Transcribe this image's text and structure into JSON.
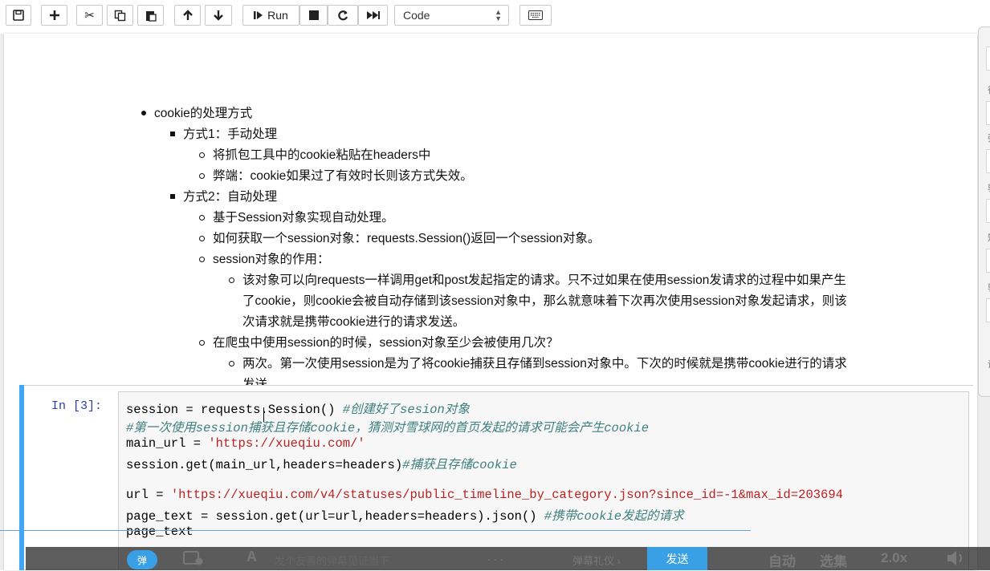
{
  "toolbar": {
    "run_label": "Run",
    "cell_type": "Code"
  },
  "markdown": {
    "items": [
      "cookie的处理方式",
      "方式1：手动处理",
      "将抓包工具中的cookie粘贴在headers中",
      "弊端：cookie如果过了有效时长则该方式失效。",
      "方式2：自动处理",
      "基于Session对象实现自动处理。",
      "如何获取一个session对象：requests.Session()返回一个session对象。",
      "session对象的作用：",
      "该对象可以向requests一样调用get和post发起指定的请求。只不过如果在使用session发请求的过程中如果产生",
      "了cookie，则cookie会被自动存储到该session对象中，那么就意味着下次再次使用session对象发起请求，则该",
      "次请求就是携带cookie进行的请求发送。",
      "在爬虫中使用session的时候，session对象至少会被使用几次？",
      "两次。第一次使用session是为了将cookie捕获且存储到session对象中。下次的时候就是携带cookie进行的请求",
      "发送。"
    ]
  },
  "code_cell": {
    "prompt": "In [3]:",
    "lines": [
      {
        "code": "session = requests.Session() ",
        "comment": "#创建好了sesion对象"
      },
      {
        "code": "",
        "comment": "#第一次使用session捕获且存储cookie，猜测对雪球网的首页发起的请求可能会产生cookie"
      },
      {
        "code": "main_url = ",
        "string": "'https://xueqiu.com/'"
      },
      {
        "code": "session.get(main_url,headers=headers)",
        "comment": "#捕获且存储cookie"
      },
      {
        "code": ""
      },
      {
        "code": "url = ",
        "string": "'https://xueqiu.com/v4/statuses/public_timeline_by_category.json?since_id=-1&max_id=203694"
      },
      {
        "code": "page_text = session.get(url=url,headers=headers).json() ",
        "comment": "#携带cookie发起的请求"
      },
      {
        "code": "page_text"
      }
    ]
  },
  "overlay": {
    "toggle_label": "弹",
    "input_placeholder": "发个友善的弹幕见证当下",
    "more": "· · ·",
    "etiquette": "弹幕礼仪 ›",
    "send_label": "发送",
    "auto_label": "自动",
    "episodes_label": "选集",
    "speed_label": "2.0x"
  },
  "right_panel": {
    "glyphs": [
      "徐",
      "弹",
      "郭",
      "知",
      "郭",
      "设"
    ]
  }
}
